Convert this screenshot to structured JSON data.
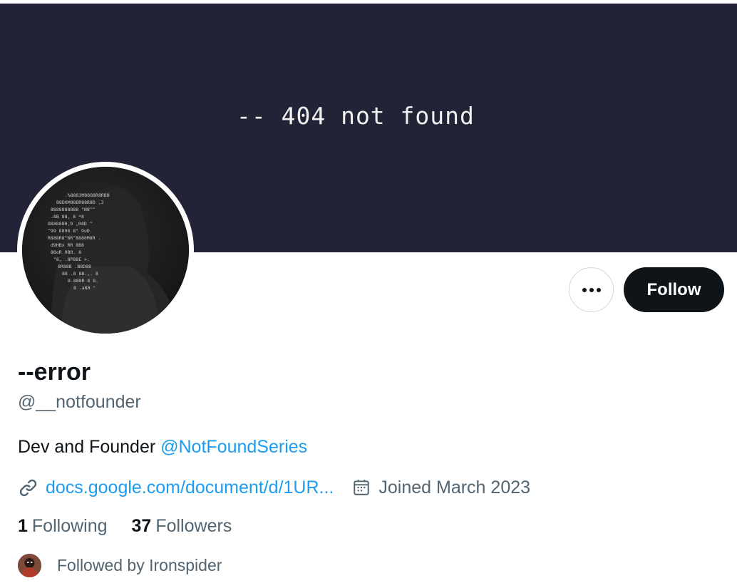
{
  "banner": {
    "text": "-- 404 not found",
    "bg": "#222336"
  },
  "profile": {
    "display_name": "--error",
    "handle": "@__notfounder",
    "bio_text": "Dev and Founder ",
    "bio_mention": "@NotFoundSeries",
    "link": "docs.google.com/document/d/1UR...",
    "joined": "Joined March 2023"
  },
  "actions": {
    "follow_label": "Follow",
    "more_icon": "more-horizontal-icon"
  },
  "stats": {
    "following_count": "1",
    "following_label": "Following",
    "followers_count": "37",
    "followers_label": "Followers"
  },
  "followed_by": {
    "text": "Followed by Ironspider"
  },
  "colors": {
    "accent": "#1d9bf0",
    "text": "#0f1419",
    "muted": "#536471",
    "button": "#0f1419"
  }
}
